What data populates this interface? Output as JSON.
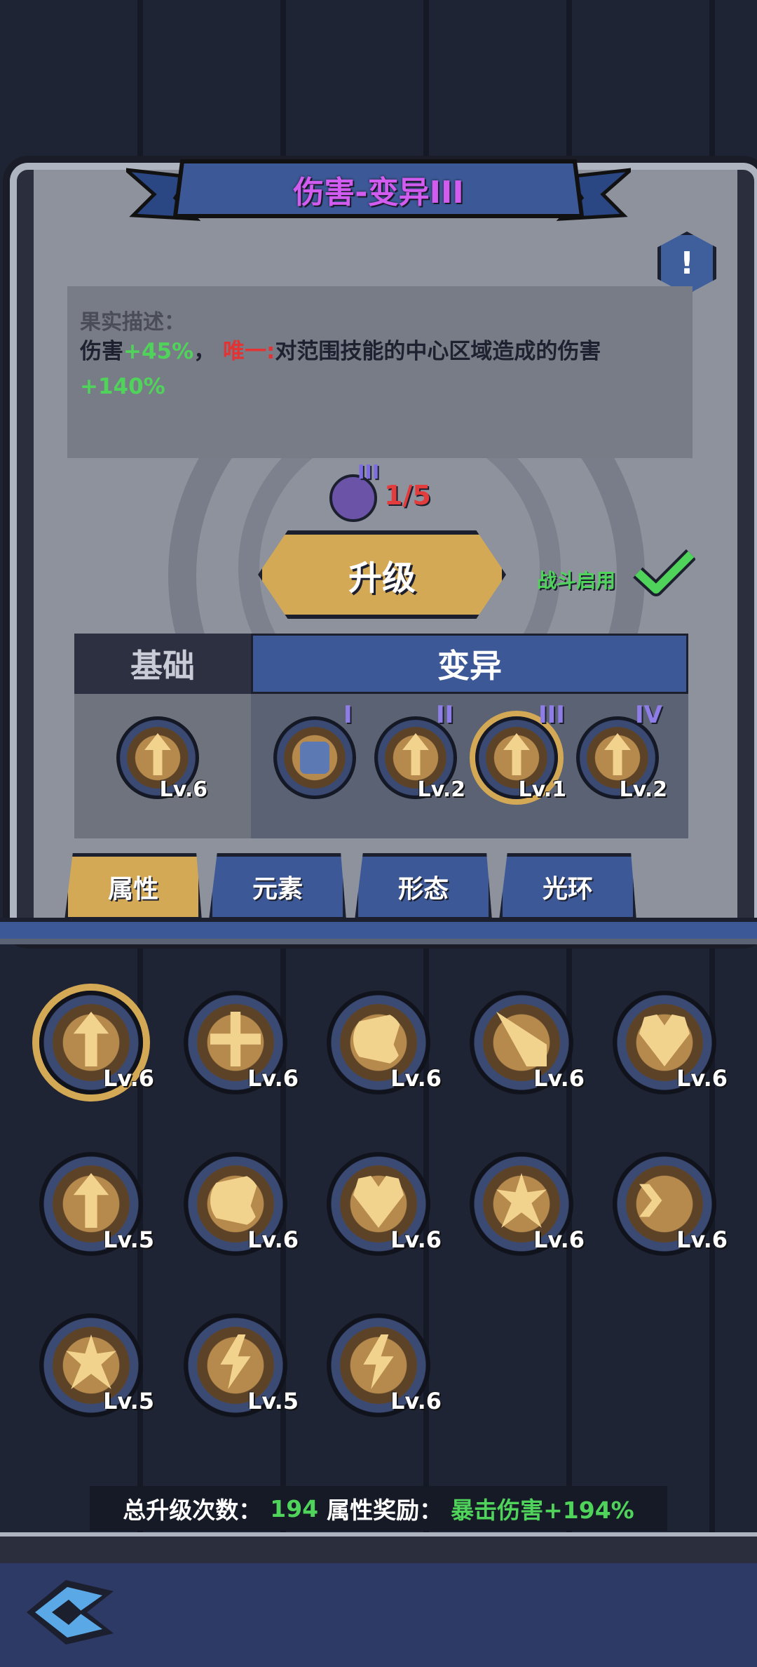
{
  "title": "伤害-变异III",
  "description": {
    "heading": "果实描述：",
    "line_prefix": "伤害",
    "bonus": "+45%",
    "separator": "，",
    "unique_label": "唯一:",
    "effect": "对范围技能的中心区域造成的伤害",
    "effect_value": "+140%"
  },
  "fruit_count": "1/5",
  "fruit_roman": "III",
  "upgrade_label": "升级",
  "combat_enabled_label": "战斗启用",
  "tree": {
    "base_header": "基础",
    "mutation_header": "变异",
    "base_node": {
      "level": "Lv.6",
      "icon": "damage-up-icon"
    },
    "mutation_nodes": [
      {
        "roman": "I",
        "level": "",
        "locked": true
      },
      {
        "roman": "II",
        "level": "Lv.2",
        "locked": false
      },
      {
        "roman": "III",
        "level": "Lv.1",
        "locked": false,
        "selected": true
      },
      {
        "roman": "IV",
        "level": "Lv.2",
        "locked": false
      }
    ]
  },
  "tabs": [
    "属性",
    "元素",
    "形态",
    "光环"
  ],
  "active_tab": 0,
  "skills": [
    {
      "level": "Lv.6",
      "icon": "damage-up-icon",
      "selected": true
    },
    {
      "level": "Lv.6",
      "icon": "spread-arrows-icon"
    },
    {
      "level": "Lv.6",
      "icon": "swirl-icon"
    },
    {
      "level": "Lv.6",
      "icon": "rays-icon"
    },
    {
      "level": "Lv.6",
      "icon": "heart-plus-icon"
    },
    {
      "level": "Lv.5",
      "icon": "rising-arrows-icon"
    },
    {
      "level": "Lv.6",
      "icon": "spiral-icon"
    },
    {
      "level": "Lv.6",
      "icon": "heart-burst-icon"
    },
    {
      "level": "Lv.6",
      "icon": "ground-burst-icon"
    },
    {
      "level": "Lv.6",
      "icon": "chevrons-icon"
    },
    {
      "level": "Lv.5",
      "icon": "explosion-icon"
    },
    {
      "level": "Lv.5",
      "icon": "shatter-icon"
    },
    {
      "level": "Lv.6",
      "icon": "lightning-icon"
    }
  ],
  "footer": {
    "total_label": "总升级次数：",
    "total_value": "194",
    "bonus_label": "属性奖励：",
    "bonus_value": "暴击伤害+194%"
  },
  "colors": {
    "accent_gold": "#d4a955",
    "accent_blue": "#3c5896",
    "title_purple": "#d25cf0",
    "positive_green": "#4fd35a",
    "unique_red": "#e23434"
  }
}
